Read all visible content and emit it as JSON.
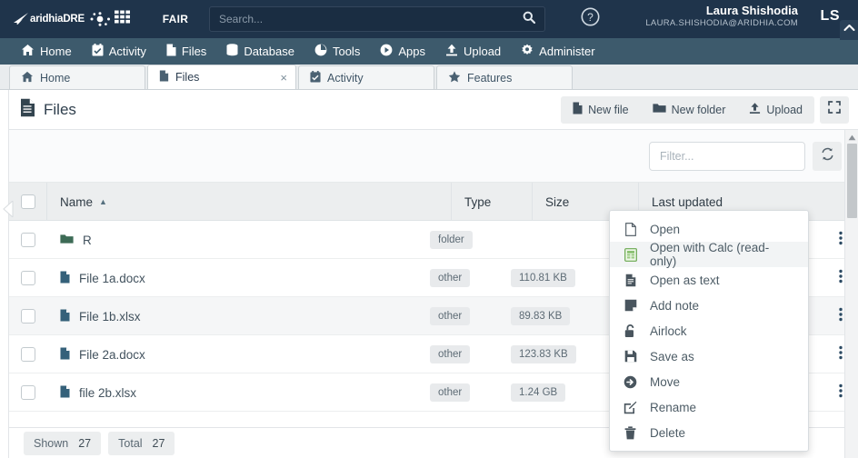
{
  "brand": {
    "logo_text_1": "aridhia",
    "logo_text_2": "DRE",
    "fair_label": "FAIR",
    "grid_icon": "grid-icon",
    "dots_icon": "molecule-dots-icon"
  },
  "search": {
    "placeholder": "Search...",
    "value": "",
    "icon": "search-icon"
  },
  "user": {
    "help_icon": "help-circle-icon",
    "name": "Laura Shishodia",
    "email": "LAURA.SHISHODIA@ARIDHIA.COM",
    "initials": "LS",
    "collapse_icon": "chevron-up-icon"
  },
  "nav": {
    "items": [
      {
        "label": "Home",
        "icon": "home-icon"
      },
      {
        "label": "Activity",
        "icon": "calendar-check-icon"
      },
      {
        "label": "Files",
        "icon": "file-icon"
      },
      {
        "label": "Database",
        "icon": "database-icon"
      },
      {
        "label": "Tools",
        "icon": "pie-chart-icon"
      },
      {
        "label": "Apps",
        "icon": "play-circle-icon"
      },
      {
        "label": "Upload",
        "icon": "upload-icon"
      },
      {
        "label": "Administer",
        "icon": "gear-icon"
      }
    ]
  },
  "tabs": [
    {
      "label": "Home",
      "icon": "home-icon",
      "active": false,
      "closable": false
    },
    {
      "label": "Files",
      "icon": "file-icon",
      "active": true,
      "closable": true,
      "close_glyph": "×"
    },
    {
      "label": "Activity",
      "icon": "calendar-check-icon",
      "active": false,
      "closable": false
    },
    {
      "label": "Features",
      "icon": "star-icon",
      "active": false,
      "closable": false
    }
  ],
  "page": {
    "title": "Files",
    "title_icon": "file-icon",
    "actions": [
      {
        "label": "New file",
        "icon": "file-icon"
      },
      {
        "label": "New folder",
        "icon": "folder-icon"
      },
      {
        "label": "Upload",
        "icon": "upload-icon"
      }
    ],
    "fullscreen_icon": "expand-icon"
  },
  "filter": {
    "placeholder": "Filter...",
    "value": "",
    "refresh_icon": "refresh-icon"
  },
  "table": {
    "columns": [
      {
        "key": "name",
        "label": "Name",
        "sorted": "asc",
        "sort_glyph": "▲"
      },
      {
        "key": "type",
        "label": "Type"
      },
      {
        "key": "size",
        "label": "Size"
      },
      {
        "key": "updated",
        "label": "Last updated"
      }
    ],
    "rows": [
      {
        "name": "R",
        "icon": "folder-icon",
        "type": "folder",
        "size": "",
        "updated": "",
        "highlighted": false
      },
      {
        "name": "File 1a.docx",
        "icon": "file-icon",
        "type": "other",
        "size": "110.81 KB",
        "updated": "",
        "highlighted": false
      },
      {
        "name": "File 1b.xlsx",
        "icon": "file-icon",
        "type": "other",
        "size": "89.83 KB",
        "updated": "",
        "highlighted": true
      },
      {
        "name": "File 2a.docx",
        "icon": "file-icon",
        "type": "other",
        "size": "123.83 KB",
        "updated": "",
        "highlighted": false
      },
      {
        "name": "file 2b.xlsx",
        "icon": "file-icon",
        "type": "other",
        "size": "1.24 GB",
        "updated": "",
        "highlighted": false
      }
    ],
    "row_menu_icon": "kebab-vertical-icon"
  },
  "context_menu": {
    "items": [
      {
        "label": "Open",
        "icon": "document-outline-icon",
        "highlighted": false
      },
      {
        "label": "Open with Calc (read-only)",
        "icon": "spreadsheet-green-icon",
        "highlighted": true
      },
      {
        "label": "Open as text",
        "icon": "document-text-icon",
        "highlighted": false
      },
      {
        "label": "Add note",
        "icon": "note-icon",
        "highlighted": false
      },
      {
        "label": "Airlock",
        "icon": "unlock-icon",
        "highlighted": false
      },
      {
        "label": "Save as",
        "icon": "save-disk-icon",
        "highlighted": false
      },
      {
        "label": "Move",
        "icon": "arrow-right-circle-icon",
        "highlighted": false
      },
      {
        "label": "Rename",
        "icon": "pencil-square-icon",
        "highlighted": false
      },
      {
        "label": "Delete",
        "icon": "trash-icon",
        "highlighted": false
      }
    ]
  },
  "footer": {
    "shown_label": "Shown",
    "shown_value": "27",
    "total_label": "Total",
    "total_value": "27"
  },
  "colors": {
    "topbar": "#1f344b",
    "navbar": "#3d5a6c",
    "accent_green": "#6aa84f",
    "text_dark": "#2f3f4d"
  }
}
